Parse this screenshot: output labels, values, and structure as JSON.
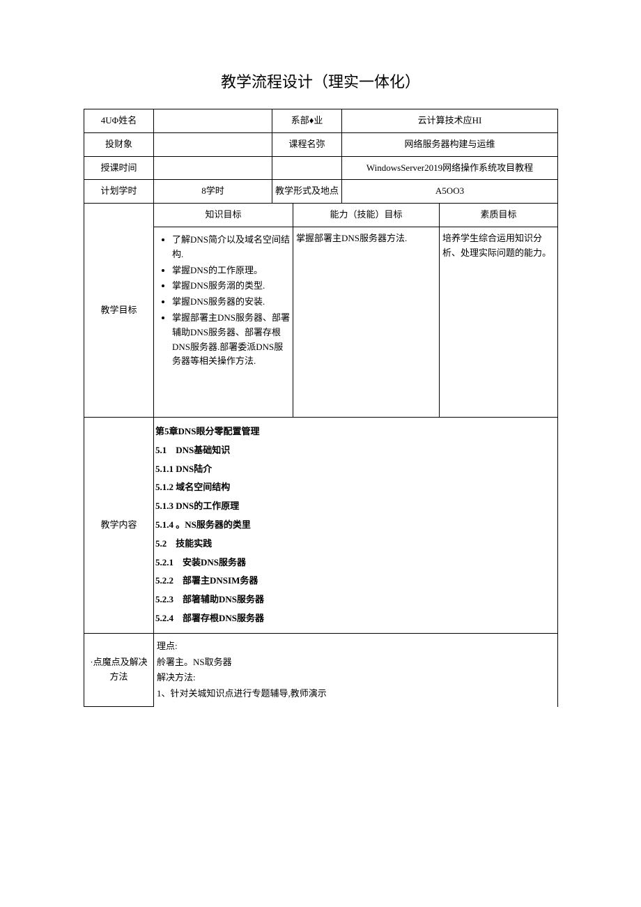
{
  "title": "教学流程设计（理实一体化）",
  "rows": {
    "r1": {
      "label": "4UΦ姓名",
      "val": "",
      "label2": "系部♦业",
      "val2": "云计算技术应HI"
    },
    "r2": {
      "label": "投财象",
      "val": "",
      "label2": "课程名弥",
      "val2": "网络服务器构建与运维"
    },
    "r3": {
      "label": "授课时间",
      "val": "",
      "label2": "",
      "val2": "WindowsServer2019网络操作系统攻目教程"
    },
    "r4": {
      "label": "计划学时",
      "val": "8学时",
      "label2": "教学形式及地点",
      "val2": "A5OO3"
    }
  },
  "goals": {
    "label": "教学目标",
    "h1": "知识目标",
    "h2": "能力（技能）目标",
    "h3": "素质目标",
    "knowledge": [
      "了解DNS简介以及域名空间结构.",
      "掌握DNS的工作原理。",
      "掌握DNS服务溺的类型.",
      "掌握DNS服务器的安装.",
      "掌握部署主DNS服务器、部署辅助DNS服务器、部署存根DNS服务器.部署委派DNS服务器等相关操作方法."
    ],
    "skill": "掌握部署主DNS服务器方法.",
    "quality": "培养学生综合运用知识分析、处理实际问题的能力。"
  },
  "content": {
    "label": "教学内容",
    "lines": [
      "第5章DNS眼分零配置管理",
      "5.1　DNS基础知识",
      "5.1.1 DNS陆介",
      "5.1.2 域名空间结构",
      "5.1.3 DNS的工作原理",
      "5.1.4 。NS服务器的类里",
      "5.2　技能实践",
      "5.2.1　安装DNS服务器",
      "5.2.2　部署主DNSIM务器",
      "5.2.3　部箸辅助DNS服务器",
      "5.2.4　部署存根DNS服务器"
    ]
  },
  "difficulty": {
    "label": "·点魔点及解决方法",
    "lines": [
      "理点:",
      "舲署主。NS取务器",
      "解决方法:",
      "1、针对关城知识点进行专题辅导,教师演示"
    ]
  }
}
